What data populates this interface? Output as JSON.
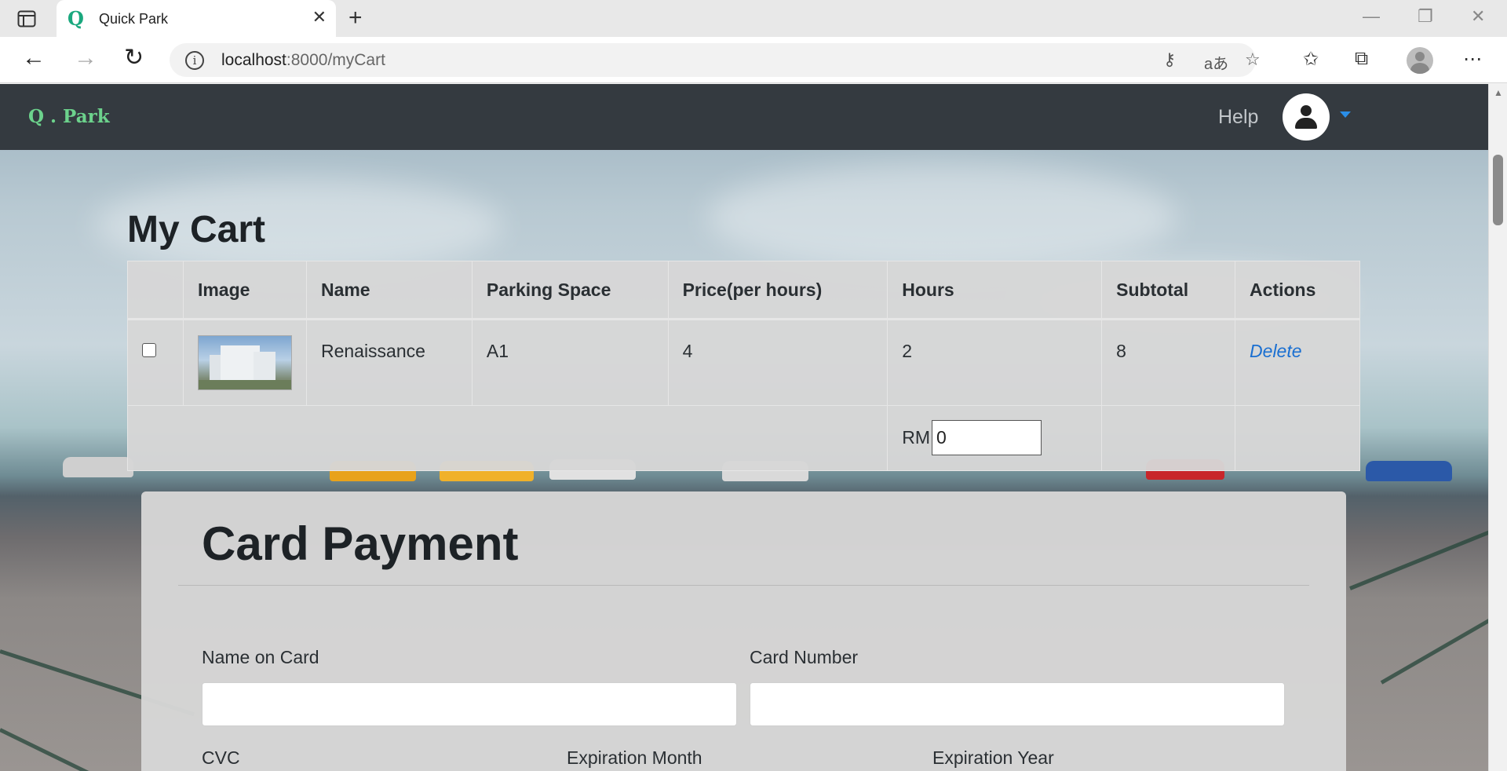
{
  "browser": {
    "tab_title": "Quick Park",
    "tab_favicon": "Q",
    "url_host": "localhost",
    "url_rest": ":8000/myCart"
  },
  "nav": {
    "brand": "Q . Park",
    "help": "Help"
  },
  "cart": {
    "title": "My Cart",
    "headers": [
      "",
      "Image",
      "Name",
      "Parking Space",
      "Price(per hours)",
      "Hours",
      "Subtotal",
      "Actions"
    ],
    "rows": [
      {
        "name": "Renaissance",
        "space": "A1",
        "price": "4",
        "hours": "2",
        "subtotal": "8",
        "action": "Delete"
      }
    ],
    "total_currency": "RM",
    "total_value": "0"
  },
  "payment": {
    "title": "Card Payment",
    "name_label": "Name on Card",
    "number_label": "Card Number",
    "cvc_label": "CVC",
    "exp_month_label": "Expiration Month",
    "exp_year_label": "Expiration Year"
  },
  "colors": {
    "navbar": "#343a40",
    "brand": "#6cd28c",
    "link": "#1a6fd1"
  }
}
